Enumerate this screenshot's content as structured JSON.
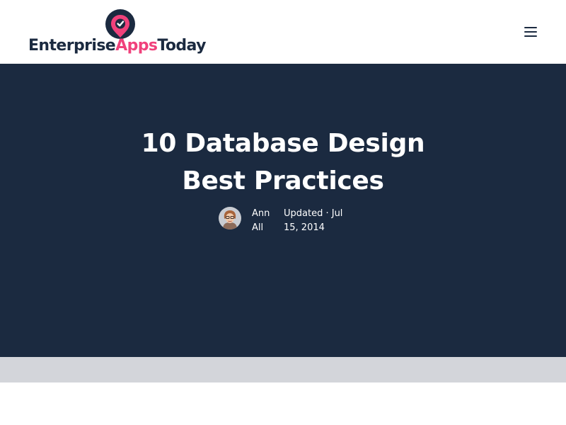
{
  "header": {
    "logo": {
      "word1": "Enterprise",
      "word2": "Apps",
      "word3": "Today"
    },
    "menu_icon": "hamburger-menu-icon"
  },
  "hero": {
    "title_line1": "10 Database Design",
    "title_line2": "Best Practices",
    "author_line1": "Ann",
    "author_line2": "All",
    "updated_line1": "Updated · Jul",
    "updated_line2": "15, 2014"
  },
  "colors": {
    "navy": "#1b2a40",
    "brand_pink": "#f0417b",
    "band_gray": "#d3d5da",
    "white": "#ffffff"
  }
}
